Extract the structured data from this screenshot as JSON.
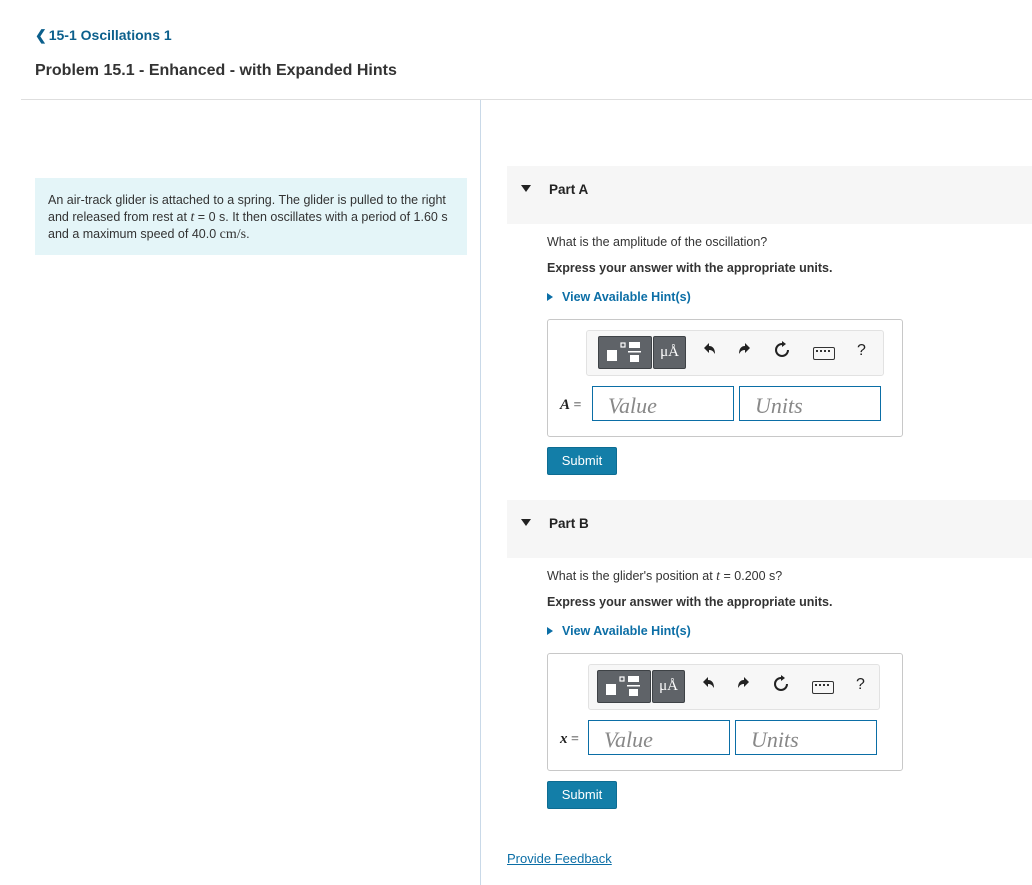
{
  "nav": {
    "back_link": "15-1 Oscillations 1"
  },
  "problem": {
    "title": "Problem 15.1 - Enhanced - with Expanded Hints",
    "text_1": "An air-track glider is attached to a spring. The glider is pulled to the right and released from rest at ",
    "t_var": "t",
    "text_2": " = 0 s. It then oscillates with a period of 1.60 s and a maximum speed of 40.0 ",
    "speed_unit": "cm/s",
    "text_3": "."
  },
  "parts": [
    {
      "label": "Part A",
      "question": "What is the amplitude of the oscillation?",
      "instruction": "Express your answer with the appropriate units.",
      "hint_link": "View Available Hint(s)",
      "var_label": "A",
      "equals": "=",
      "value_placeholder": "Value",
      "units_placeholder": "Units",
      "submit_label": "Submit"
    },
    {
      "label": "Part B",
      "question_1": "What is the glider's position at ",
      "question_var": "t",
      "question_2": " = 0.200 s?",
      "instruction": "Express your answer with the appropriate units.",
      "hint_link": "View Available Hint(s)",
      "var_label": "x",
      "equals": "=",
      "value_placeholder": "Value",
      "units_placeholder": "Units",
      "submit_label": "Submit"
    }
  ],
  "toolbar": {
    "units_symbol": "μÅ",
    "help": "?",
    "icons": [
      "templates-icon",
      "units-icon",
      "undo-icon",
      "redo-icon",
      "reset-icon",
      "keyboard-icon",
      "help-icon"
    ]
  },
  "footer": {
    "feedback_link": "Provide Feedback"
  },
  "colors": {
    "accent": "#0b6ea6",
    "submit": "#137ea8",
    "problem_bg": "#e4f5f8"
  }
}
